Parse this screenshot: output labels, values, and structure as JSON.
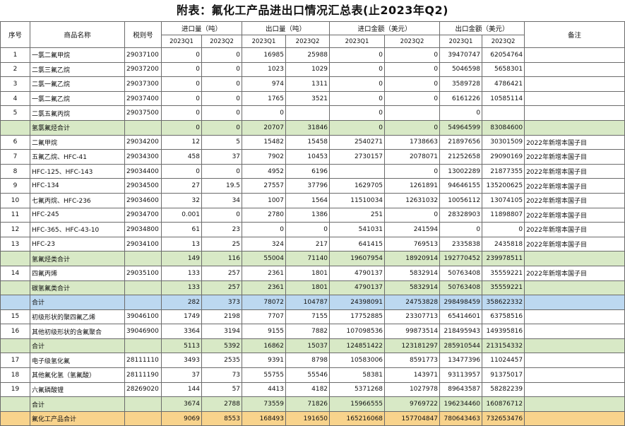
{
  "title": "附表：氟化工产品进出口情况汇总表(止2023年Q2)",
  "columns": {
    "seq": "序号",
    "name": "商品名称",
    "code": "税则号",
    "import_qty": "进口量（吨）",
    "export_qty": "出口量（吨）",
    "import_amt": "进口金额（美元）",
    "export_amt": "出口金额（美元）",
    "note": "备注",
    "periods": [
      "2023Q1",
      "2023Q2",
      "2023Q1",
      "2023Q2",
      "2023Q1",
      "2023Q2",
      "2023Q1",
      "2023Q2"
    ]
  },
  "rows": [
    {
      "seq": "1",
      "name": "一氯二氟甲烷",
      "code": "29037100",
      "values": [
        "0",
        "0",
        "16985",
        "25988",
        "0",
        "0",
        "39470747",
        "62054764"
      ],
      "note": "",
      "style": ""
    },
    {
      "seq": "2",
      "name": "二氯三氟乙烷",
      "code": "29037200",
      "values": [
        "0",
        "0",
        "1023",
        "1029",
        "0",
        "0",
        "5046598",
        "5658301"
      ],
      "note": "",
      "style": ""
    },
    {
      "seq": "3",
      "name": "二氯一氟乙烷",
      "code": "29037300",
      "values": [
        "0",
        "0",
        "974",
        "1311",
        "0",
        "0",
        "3589728",
        "4786421"
      ],
      "note": "",
      "style": ""
    },
    {
      "seq": "4",
      "name": "一氯二氟乙烷",
      "code": "29037400",
      "values": [
        "0",
        "0",
        "1765",
        "3521",
        "0",
        "0",
        "6161226",
        "10585114"
      ],
      "note": "",
      "style": ""
    },
    {
      "seq": "5",
      "name": "二氯五氟丙烷",
      "code": "29037500",
      "values": [
        "0",
        "0",
        "0",
        "",
        "0",
        "",
        "0",
        ""
      ],
      "note": "",
      "style": ""
    },
    {
      "seq": "",
      "name": "氢氯氟烃合计",
      "code": "",
      "values": [
        "0",
        "0",
        "20707",
        "31846",
        "0",
        "0",
        "54964599",
        "83084600"
      ],
      "note": "",
      "style": "green"
    },
    {
      "seq": "6",
      "name": "二氟甲烷",
      "code": "29034200",
      "values": [
        "12",
        "5",
        "15482",
        "15458",
        "2540271",
        "1738663",
        "21897656",
        "30301509"
      ],
      "note": "2022年新增本国子目",
      "style": ""
    },
    {
      "seq": "7",
      "name": "五氟乙烷、HFC-41",
      "code": "29034300",
      "values": [
        "458",
        "37",
        "7902",
        "10453",
        "2730157",
        "2078071",
        "21252658",
        "29090169"
      ],
      "note": "2022年新增本国子目",
      "style": ""
    },
    {
      "seq": "8",
      "name": "HFC-125、HFC-143",
      "code": "29034400",
      "values": [
        "0",
        "0",
        "4952",
        "6196",
        "",
        "0",
        "13002289",
        "21877355"
      ],
      "note": "2022年新增本国子目",
      "style": ""
    },
    {
      "seq": "9",
      "name": "HFC-134",
      "code": "29034500",
      "values": [
        "27",
        "19.5",
        "27557",
        "37796",
        "1629705",
        "1261891",
        "94646155",
        "135200625"
      ],
      "note": "2022年新增本国子目",
      "style": ""
    },
    {
      "seq": "10",
      "name": "七氟丙烷、HFC-236",
      "code": "29034600",
      "values": [
        "32",
        "34",
        "1007",
        "1564",
        "11510034",
        "12631032",
        "10056112",
        "13074105"
      ],
      "note": "2022年新增本国子目",
      "style": ""
    },
    {
      "seq": "11",
      "name": "HFC-245",
      "code": "29034700",
      "values": [
        "0.001",
        "0",
        "2780",
        "1386",
        "251",
        "0",
        "28328903",
        "11898807"
      ],
      "note": "2022年新增本国子目",
      "style": ""
    },
    {
      "seq": "12",
      "name": "HFC-365、HFC-43-10",
      "code": "29034800",
      "values": [
        "61",
        "23",
        "0",
        "0",
        "541031",
        "241594",
        "0",
        "0"
      ],
      "note": "2022年新增本国子目",
      "style": ""
    },
    {
      "seq": "13",
      "name": "HFC-23",
      "code": "29034100",
      "values": [
        "13",
        "25",
        "324",
        "217",
        "641415",
        "769513",
        "2335838",
        "2435818"
      ],
      "note": "2022年新增本国子目",
      "style": ""
    },
    {
      "seq": "",
      "name": "氢氟烃类合计",
      "code": "",
      "values": [
        "149",
        "116",
        "55004",
        "71140",
        "19607954",
        "18920914",
        "192770452",
        "239978511"
      ],
      "note": "",
      "style": "green"
    },
    {
      "seq": "14",
      "name": "四氟丙烯",
      "code": "29035100",
      "values": [
        "133",
        "257",
        "2361",
        "1801",
        "4790137",
        "5832914",
        "50763408",
        "35559221"
      ],
      "note": "2022年新增本国子目",
      "style": ""
    },
    {
      "seq": "",
      "name": "碳氢氟类合计",
      "code": "",
      "values": [
        "133",
        "257",
        "2361",
        "1801",
        "4790137",
        "5832914",
        "50763408",
        "35559221"
      ],
      "note": "",
      "style": "green"
    },
    {
      "seq": "",
      "name": "合计",
      "code": "",
      "values": [
        "282",
        "373",
        "78072",
        "104787",
        "24398091",
        "24753828",
        "298498459",
        "358622332"
      ],
      "note": "",
      "style": "blue"
    },
    {
      "seq": "15",
      "name": "初级形状的聚四氟乙烯",
      "code": "39046100",
      "values": [
        "1749",
        "2198",
        "7707",
        "7155",
        "17752885",
        "23307713",
        "65414601",
        "63758516"
      ],
      "note": "",
      "style": ""
    },
    {
      "seq": "16",
      "name": "其他初级形状的含氟聚合",
      "code": "39046900",
      "values": [
        "3364",
        "3194",
        "9155",
        "7882",
        "107098536",
        "99873514",
        "218495943",
        "149395816"
      ],
      "note": "",
      "style": ""
    },
    {
      "seq": "",
      "name": "合计",
      "code": "",
      "values": [
        "5113",
        "5392",
        "16862",
        "15037",
        "124851422",
        "123181297",
        "285910544",
        "213154332"
      ],
      "note": "",
      "style": "green"
    },
    {
      "seq": "17",
      "name": "电子级氢化氟",
      "code": "28111110",
      "values": [
        "3493",
        "2535",
        "9391",
        "8798",
        "10583006",
        "8591773",
        "13477396",
        "11024457"
      ],
      "note": "",
      "style": ""
    },
    {
      "seq": "18",
      "name": "其他氟化氢（氢氟酸）",
      "code": "28111190",
      "values": [
        "37",
        "73",
        "55755",
        "55546",
        "58381",
        "143971",
        "93113957",
        "91375017"
      ],
      "note": "",
      "style": ""
    },
    {
      "seq": "19",
      "name": "六氟磷酸锂",
      "code": "28269020",
      "values": [
        "144",
        "57",
        "4413",
        "4182",
        "5371268",
        "1027978",
        "89643587",
        "58282239"
      ],
      "note": "",
      "style": ""
    },
    {
      "seq": "",
      "name": "合计",
      "code": "",
      "values": [
        "3674",
        "2788",
        "73559",
        "71826",
        "15966555",
        "9769722",
        "196234460",
        "160876712"
      ],
      "note": "",
      "style": "green"
    },
    {
      "seq": "",
      "name": "氟化工产品合计",
      "code": "",
      "values": [
        "9069",
        "8553",
        "168493",
        "191650",
        "165216068",
        "157704847",
        "780643463",
        "732653476"
      ],
      "note": "",
      "style": "orange"
    }
  ]
}
